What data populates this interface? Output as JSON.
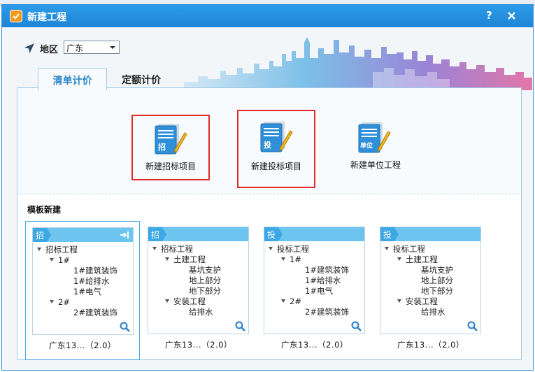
{
  "window": {
    "title": "新建工程",
    "help_label": "?",
    "close": "close-icon"
  },
  "region": {
    "label": "地区",
    "value": "广东",
    "icon": "location-arrow-icon"
  },
  "tabs": [
    {
      "label": "清单计价",
      "active": true
    },
    {
      "label": "定额计价",
      "active": false
    }
  ],
  "create_actions": [
    {
      "label": "新建招标项目",
      "badge": "招",
      "highlighted": true
    },
    {
      "label": "新建投标项目",
      "badge": "投",
      "highlighted": true
    },
    {
      "label": "新建单位工程",
      "badge": "单位",
      "highlighted": false
    }
  ],
  "templates_title": "模板新建",
  "templates": [
    {
      "badge": "招",
      "selected": true,
      "tree": [
        {
          "label": "招标工程",
          "expanded": true
        },
        {
          "label": "1#",
          "expanded": true
        },
        {
          "label": "1#建筑装饰"
        },
        {
          "label": "1#给排水"
        },
        {
          "label": "1#电气"
        },
        {
          "label": "2#",
          "expanded": true
        },
        {
          "label": "2#建筑装饰"
        }
      ],
      "footer": "广东13...（2.0）"
    },
    {
      "badge": "招",
      "selected": false,
      "tree": [
        {
          "label": "招标工程",
          "expanded": true
        },
        {
          "label": "土建工程",
          "expanded": true
        },
        {
          "label": "基坑支护"
        },
        {
          "label": "地上部分"
        },
        {
          "label": "地下部分"
        },
        {
          "label": "安装工程",
          "expanded": true
        },
        {
          "label": "给排水"
        }
      ],
      "footer": "广东13...（2.0）"
    },
    {
      "badge": "投",
      "selected": false,
      "tree": [
        {
          "label": "投标工程",
          "expanded": true
        },
        {
          "label": "1#",
          "expanded": true
        },
        {
          "label": "1#建筑装饰"
        },
        {
          "label": "1#给排水"
        },
        {
          "label": "1#电气"
        },
        {
          "label": "2#",
          "expanded": true
        },
        {
          "label": "2#建筑装饰"
        }
      ],
      "footer": "广东13...（2.0）"
    },
    {
      "badge": "投",
      "selected": false,
      "tree": [
        {
          "label": "投标工程",
          "expanded": true
        },
        {
          "label": "土建工程",
          "expanded": true
        },
        {
          "label": "基坑支护"
        },
        {
          "label": "地上部分"
        },
        {
          "label": "地下部分"
        },
        {
          "label": "安装工程",
          "expanded": true
        },
        {
          "label": "给排水"
        }
      ],
      "footer": "广东13...（2.0）"
    }
  ],
  "colors": {
    "titlebar": "#1d84d6",
    "highlight": "#e02b2b",
    "template_header": "#6dc4ee",
    "badge": "#3ea8e5"
  }
}
